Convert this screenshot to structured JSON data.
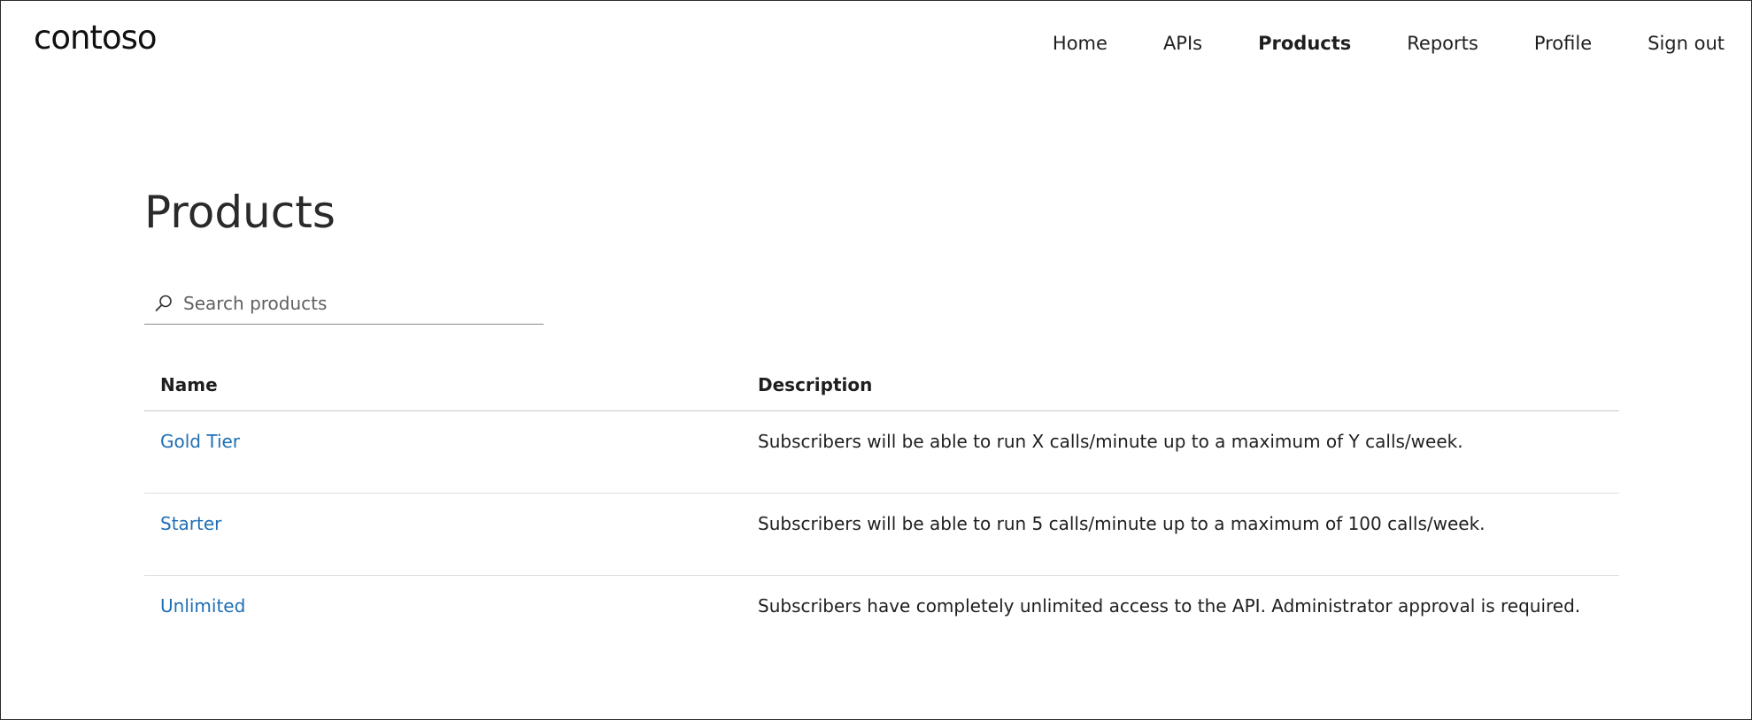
{
  "header": {
    "logo": "contoso",
    "nav": [
      {
        "label": "Home",
        "active": false
      },
      {
        "label": "APIs",
        "active": false
      },
      {
        "label": "Products",
        "active": true
      },
      {
        "label": "Reports",
        "active": false
      },
      {
        "label": "Profile",
        "active": false
      },
      {
        "label": "Sign out",
        "active": false
      }
    ]
  },
  "main": {
    "title": "Products",
    "search": {
      "placeholder": "Search products",
      "value": "",
      "icon": "search-icon"
    },
    "table": {
      "columns": [
        "Name",
        "Description"
      ],
      "rows": [
        {
          "name": "Gold Tier",
          "description": "Subscribers will be able to run X calls/minute up to a maximum of Y calls/week."
        },
        {
          "name": "Starter",
          "description": "Subscribers will be able to run 5 calls/minute up to a maximum of 100 calls/week."
        },
        {
          "name": "Unlimited",
          "description": "Subscribers have completely unlimited access to the API. Administrator approval is required."
        }
      ]
    }
  },
  "colors": {
    "link": "#1f6fb5",
    "text": "#1f1f1f",
    "divider": "#dedede"
  }
}
